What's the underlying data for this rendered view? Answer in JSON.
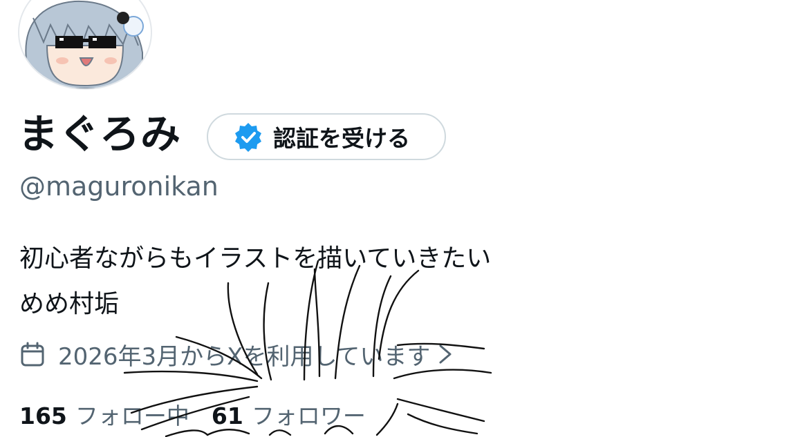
{
  "profile": {
    "display_name": "まぐろみ",
    "handle": "@maguronikan",
    "verify_button_label": "認証を受ける",
    "bio_line1": "初心者ながらもイラストを描いていきたい",
    "bio_line2": "めめ村垢",
    "joined_text": "2026年3月からXを利用しています",
    "following_count": "165",
    "following_label": "フォロー中",
    "followers_count": "61",
    "followers_label": "フォロワー"
  },
  "icons": {
    "verified": "verified-badge-icon",
    "calendar": "calendar-icon",
    "chevron": "chevron-right-icon"
  },
  "colors": {
    "accent": "#1d9bf0",
    "secondary_text": "#536471",
    "primary_text": "#0f1419",
    "border": "#cfd9de"
  }
}
